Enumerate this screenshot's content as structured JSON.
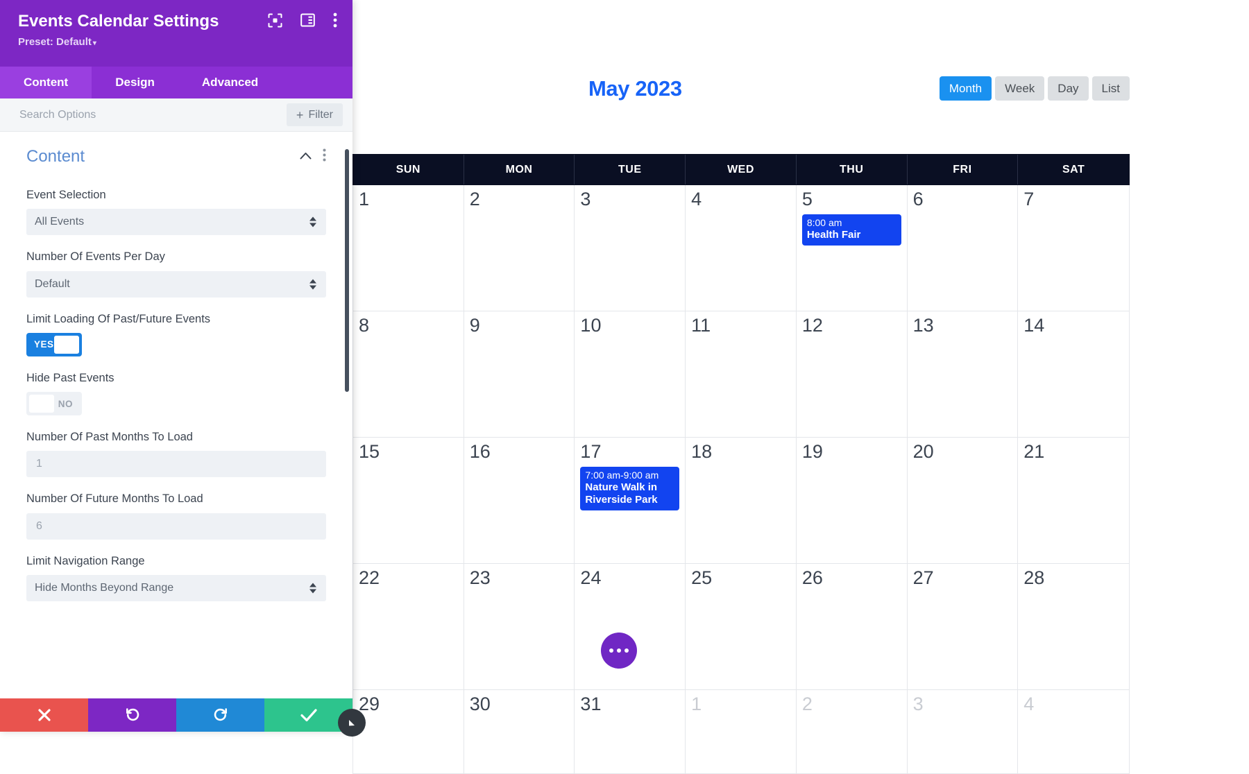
{
  "panel": {
    "title": "Events Calendar Settings",
    "preset": "Preset: Default",
    "preset_caret": "▾",
    "header_icons": [
      {
        "name": "focus-target-icon"
      },
      {
        "name": "layout-columns-icon"
      },
      {
        "name": "kebab-menu-icon"
      }
    ],
    "tabs": [
      {
        "label": "Content",
        "active": true
      },
      {
        "label": "Design",
        "active": false
      },
      {
        "label": "Advanced",
        "active": false
      }
    ],
    "search": {
      "placeholder": "Search Options",
      "value": ""
    },
    "filter_button": {
      "label": "Filter",
      "plus": "+"
    },
    "section": {
      "title": "Content",
      "collapse_icon": "chevron-up-icon",
      "menu_icon": "kebab-menu-icon"
    },
    "fields": [
      {
        "type": "select",
        "label": "Event Selection",
        "value": "All Events",
        "name": "event-selection"
      },
      {
        "type": "select",
        "label": "Number Of Events Per Day",
        "value": "Default",
        "name": "events-per-day"
      },
      {
        "type": "toggle",
        "label": "Limit Loading Of Past/Future Events",
        "value": "YES",
        "state": "on",
        "name": "limit-loading-toggle"
      },
      {
        "type": "toggle",
        "label": "Hide Past Events",
        "value": "NO",
        "state": "off",
        "name": "hide-past-events-toggle"
      },
      {
        "type": "number",
        "label": "Number Of Past Months To Load",
        "value": "",
        "placeholder": "1",
        "name": "past-months-input"
      },
      {
        "type": "number",
        "label": "Number Of Future Months To Load",
        "value": "",
        "placeholder": "6",
        "name": "future-months-input"
      },
      {
        "type": "select",
        "label": "Limit Navigation Range",
        "value": "Hide Months Beyond Range",
        "name": "limit-navigation-range"
      }
    ],
    "footer_buttons": [
      {
        "name": "cancel-button",
        "icon": "close-x-icon",
        "color": "#e9534e"
      },
      {
        "name": "undo-button",
        "icon": "undo-arrow-icon",
        "color": "#7d27c4"
      },
      {
        "name": "redo-button",
        "icon": "redo-arrow-icon",
        "color": "#2089d6"
      },
      {
        "name": "save-button",
        "icon": "checkmark-icon",
        "color": "#2dc48d"
      }
    ]
  },
  "calendar": {
    "title": "May 2023",
    "title_color": "#1763f7",
    "views": [
      {
        "label": "Month",
        "active": true
      },
      {
        "label": "Week",
        "active": false
      },
      {
        "label": "Day",
        "active": false
      },
      {
        "label": "List",
        "active": false
      }
    ],
    "day_headers": [
      "SUN",
      "MON",
      "TUE",
      "WED",
      "THU",
      "FRI",
      "SAT"
    ],
    "more_button": {
      "name": "more-options-fab",
      "icon": "ellipsis-icon",
      "color": "#7027c4"
    },
    "weeks": [
      {
        "days": [
          {
            "num": "1",
            "other": false,
            "events": []
          },
          {
            "num": "2",
            "other": false,
            "events": []
          },
          {
            "num": "3",
            "other": false,
            "events": []
          },
          {
            "num": "4",
            "other": false,
            "events": []
          },
          {
            "num": "5",
            "other": false,
            "events": [
              {
                "time": "8:00 am",
                "title": "Health Fair"
              }
            ]
          },
          {
            "num": "6",
            "other": false,
            "events": []
          },
          {
            "num": "7",
            "other": false,
            "events": []
          }
        ]
      },
      {
        "days": [
          {
            "num": "8",
            "other": false,
            "events": []
          },
          {
            "num": "9",
            "other": false,
            "events": []
          },
          {
            "num": "10",
            "other": false,
            "events": []
          },
          {
            "num": "11",
            "other": false,
            "events": []
          },
          {
            "num": "12",
            "other": false,
            "events": []
          },
          {
            "num": "13",
            "other": false,
            "events": []
          },
          {
            "num": "14",
            "other": false,
            "events": []
          }
        ]
      },
      {
        "days": [
          {
            "num": "15",
            "other": false,
            "events": []
          },
          {
            "num": "16",
            "other": false,
            "events": []
          },
          {
            "num": "17",
            "other": false,
            "events": [
              {
                "time": "7:00 am-9:00 am",
                "title": "Nature Walk in Riverside Park"
              }
            ]
          },
          {
            "num": "18",
            "other": false,
            "events": []
          },
          {
            "num": "19",
            "other": false,
            "events": []
          },
          {
            "num": "20",
            "other": false,
            "events": []
          },
          {
            "num": "21",
            "other": false,
            "events": []
          }
        ]
      },
      {
        "days": [
          {
            "num": "22",
            "other": false,
            "events": []
          },
          {
            "num": "23",
            "other": false,
            "events": []
          },
          {
            "num": "24",
            "other": false,
            "events": []
          },
          {
            "num": "25",
            "other": false,
            "events": []
          },
          {
            "num": "26",
            "other": false,
            "events": []
          },
          {
            "num": "27",
            "other": false,
            "events": []
          },
          {
            "num": "28",
            "other": false,
            "events": []
          }
        ]
      },
      {
        "days": [
          {
            "num": "29",
            "other": false,
            "events": []
          },
          {
            "num": "30",
            "other": false,
            "events": []
          },
          {
            "num": "31",
            "other": false,
            "events": []
          },
          {
            "num": "1",
            "other": true,
            "events": []
          },
          {
            "num": "2",
            "other": true,
            "events": []
          },
          {
            "num": "3",
            "other": true,
            "events": []
          },
          {
            "num": "4",
            "other": true,
            "events": []
          }
        ]
      }
    ]
  }
}
